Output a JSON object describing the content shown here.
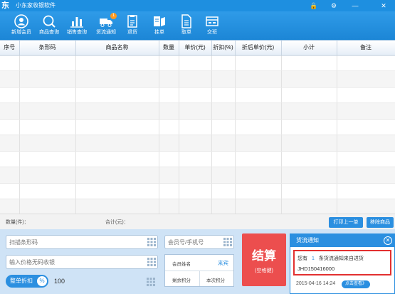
{
  "window": {
    "logo": "东",
    "title": "小东家收银软件",
    "controls": [
      "🔒",
      "⚙",
      "—",
      "✕"
    ]
  },
  "toolbar": {
    "items": [
      {
        "label": "新增会员",
        "icon": "add-member-icon"
      },
      {
        "label": "商品查询",
        "icon": "search-icon"
      },
      {
        "label": "销售查询",
        "icon": "bar-chart-icon"
      },
      {
        "label": "货流通知",
        "icon": "truck-icon",
        "badge": "1"
      },
      {
        "label": "退货",
        "icon": "return-goods-icon"
      },
      {
        "label": "挂单",
        "icon": "hang-order-icon"
      },
      {
        "label": "取单",
        "icon": "retrieve-order-icon"
      },
      {
        "label": "交班",
        "icon": "shift-handover-icon"
      }
    ]
  },
  "grid": {
    "columns": [
      "序号",
      "条形码",
      "商品名称",
      "数量",
      "单价(元)",
      "折扣(%)",
      "折后单价(元)",
      "小计",
      "备注"
    ]
  },
  "summary": {
    "qty_label": "数量(件)：",
    "total_label": "合计(元)：",
    "reprint_button": "打印上一单",
    "remove_button": "移除商品"
  },
  "inputs": {
    "barcode_placeholder": "扫描条形码",
    "noprice_placeholder": "输入价格无码收银",
    "member_placeholder": "会员号/手机号"
  },
  "member": {
    "name_label": "会员姓名",
    "name_value": "来宾",
    "remaining_points_label": "剩余积分",
    "current_points_label": "本次积分"
  },
  "discount": {
    "button_label": "整单折扣",
    "percent_symbol": "%",
    "value": "100"
  },
  "checkout": {
    "label": "结算",
    "hint": "(空格键)"
  },
  "notification": {
    "title": "货流通知",
    "close": "✕",
    "line_prefix": "您有",
    "count": "1",
    "line_suffix": "条货流通知来自进货",
    "code": "JHD150416000",
    "time": "2015-04-16 14:24",
    "view_link": "点击查看》"
  },
  "colors": {
    "titlebar": "#1e8fe0",
    "accent": "#2b8fe0",
    "checkout": "#ec4e4e",
    "highlight_border": "#e23030",
    "badge": "#ff9a1f"
  }
}
